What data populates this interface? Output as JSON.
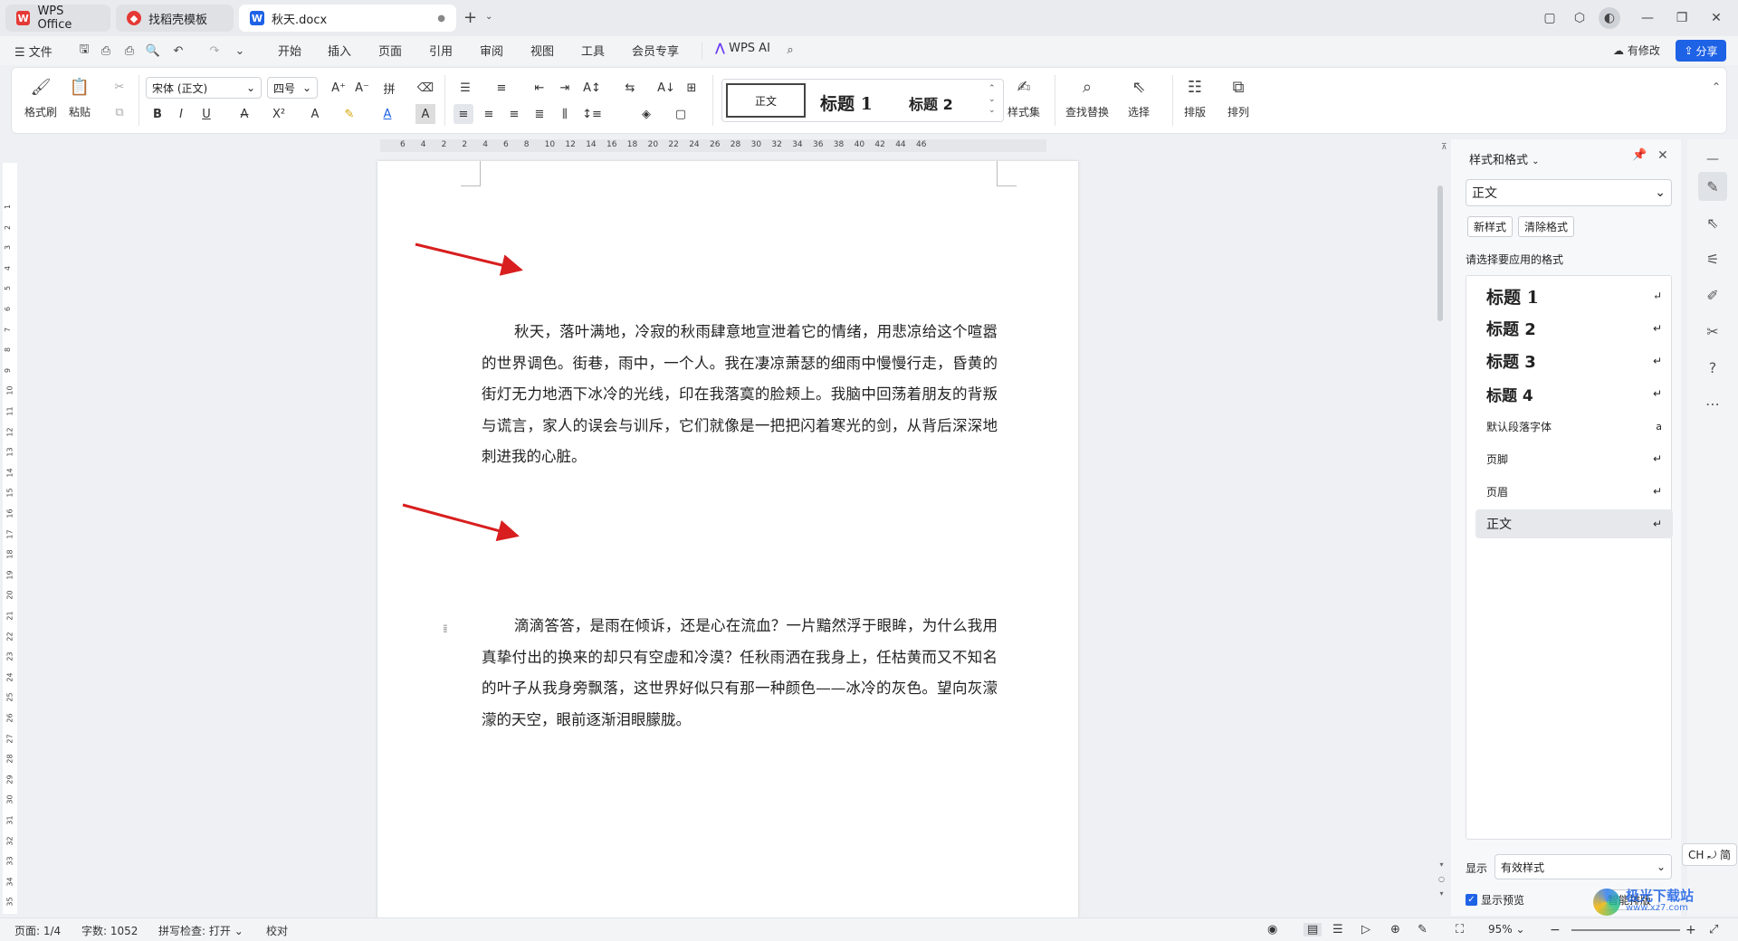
{
  "tabs": [
    {
      "label": "WPS Office",
      "color": "#e53935"
    },
    {
      "label": "找稻壳模板",
      "color": "#e53935"
    },
    {
      "label": "秋天.docx",
      "color": "#1e62e6"
    }
  ],
  "titlebar": {
    "new_tab": "+"
  },
  "menu": {
    "file": "文件",
    "items": [
      "开始",
      "插入",
      "页面",
      "引用",
      "审阅",
      "视图",
      "工具",
      "会员专享"
    ],
    "active": "开始",
    "wps_ai": "WPS AI",
    "modified": "有修改",
    "share": "分享"
  },
  "ribbon": {
    "format_painter": "格式刷",
    "paste": "粘贴",
    "font_name": "宋体 (正文)",
    "font_size": "四号",
    "styles": [
      "正文",
      "标题 1",
      "标题 2"
    ],
    "style_set": "样式集",
    "find_replace": "查找替换",
    "select": "选择",
    "layout": "排版",
    "arrange": "排列"
  },
  "ruler": {
    "h_ticks": [
      "6",
      "4",
      "2",
      "2",
      "4",
      "6",
      "8",
      "10",
      "12",
      "14",
      "16",
      "18",
      "20",
      "22",
      "24",
      "26",
      "28",
      "30",
      "32",
      "34",
      "36",
      "38",
      "40",
      "42",
      "44",
      "46"
    ],
    "v_ticks": [
      "1",
      "2",
      "3",
      "4",
      "5",
      "6",
      "7",
      "8",
      "9",
      "10",
      "11",
      "12",
      "13",
      "14",
      "15",
      "16",
      "17",
      "18",
      "19",
      "20",
      "21",
      "22",
      "23",
      "24",
      "25",
      "26",
      "27",
      "28",
      "29",
      "30",
      "31",
      "32",
      "33",
      "34",
      "35"
    ]
  },
  "document": {
    "para1": "秋天，落叶满地，冷寂的秋雨肆意地宣泄着它的情绪，用悲凉给这个喧嚣的世界调色。街巷，雨中，一个人。我在凄凉萧瑟的细雨中慢慢行走，昏黄的街灯无力地洒下冰冷的光线，印在我落寞的脸颊上。我脑中回荡着朋友的背叛与谎言，家人的误会与训斥，它们就像是一把把闪着寒光的剑，从背后深深地刺进我的心脏。",
    "para2": "滴滴答答，是雨在倾诉，还是心在流血？一片黯然浮于眼眸，为什么我用真挚付出的换来的却只有空虚和冷漠？任秋雨洒在我身上，任枯黄而又不知名的叶子从我身旁飘落，这世界好似只有那一种颜色——冰冷的灰色。望向灰濛濛的天空，眼前逐渐泪眼朦胧。",
    "arrow_color": "#d81e1e"
  },
  "panel": {
    "title": "样式和格式",
    "current": "正文",
    "new_style": "新样式",
    "clear_format": "清除格式",
    "prompt": "请选择要应用的格式",
    "styles": [
      {
        "label": "标题  1",
        "mark": "↵"
      },
      {
        "label": "标题  2",
        "mark": "↵"
      },
      {
        "label": "标题  3",
        "mark": "↵"
      },
      {
        "label": "标题 4",
        "mark": "↵"
      },
      {
        "label": "默认段落字体",
        "mark": "a"
      },
      {
        "label": "页脚",
        "mark": "↵"
      },
      {
        "label": "页眉",
        "mark": "↵"
      },
      {
        "label": "正文",
        "mark": "↵"
      }
    ],
    "show_label": "显示",
    "show_value": "有效样式",
    "preview": "显示预览",
    "smart_layout": "智能排版",
    "ime": "CH ⤾ 简"
  },
  "status": {
    "page": "页面: 1/4",
    "words": "字数: 1052",
    "spell": "拼写检查: 打开",
    "proof": "校对",
    "zoom": "95%"
  },
  "watermark": "极光下载站",
  "watermark_url": "www.xz7.com"
}
